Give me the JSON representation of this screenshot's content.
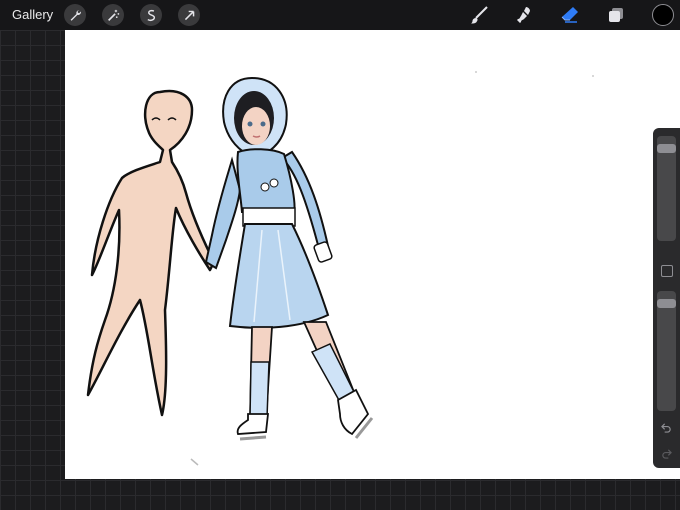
{
  "topbar": {
    "gallery_label": "Gallery",
    "left_tools": [
      "wrench-icon",
      "magic-wand-icon",
      "selection-icon",
      "transform-icon"
    ],
    "right_tools": [
      "brush-icon",
      "smudge-icon",
      "eraser-icon",
      "layers-icon"
    ],
    "active_tool": "eraser",
    "accent_color": "#2f7cf6",
    "current_color": "#000000"
  },
  "sidebar": {
    "brush_size_level": 0.05,
    "opacity_level": 0.05,
    "icons": [
      "modify-icon",
      "undo-icon",
      "redo-icon"
    ]
  }
}
